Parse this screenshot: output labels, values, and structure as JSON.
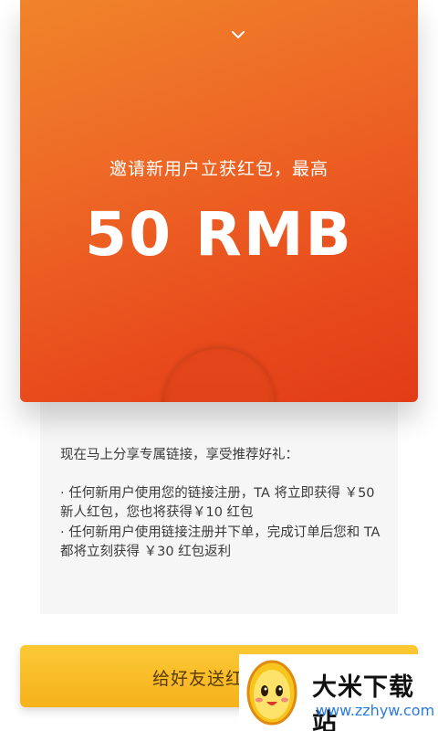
{
  "envelope": {
    "subtitle": "邀请新用户立获红包，最高",
    "amount": "50 RMB"
  },
  "card": {
    "intro": "现在马上分享专属链接，享受推荐好礼：",
    "rule1": "· 任何新用户使用您的链接注册，TA 将立即获得 ￥50 新人红包，您也将获得￥10 红包",
    "rule2": "· 任何新用户使用链接注册并下单，完成订单后您和 TA 都将立刻获得 ￥30 红包返利"
  },
  "share_button": {
    "label": "给好友送红"
  },
  "watermark": {
    "title": "大米下载站",
    "url": "www.zzhyw.com"
  },
  "colors": {
    "envelope_top": "#f0842a",
    "envelope_bottom": "#e23c16",
    "button": "#f9bf2a"
  },
  "icons": {
    "collapse": "chevron-down-icon"
  }
}
